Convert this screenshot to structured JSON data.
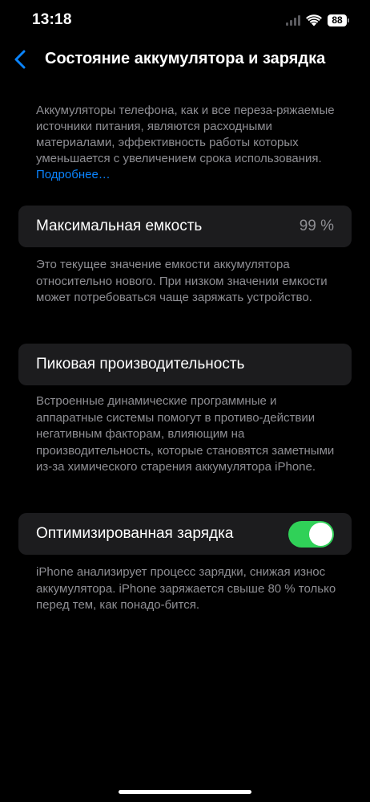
{
  "status_bar": {
    "time": "13:18",
    "battery_level": "88"
  },
  "nav": {
    "title": "Состояние аккумулятора и зарядка"
  },
  "intro": {
    "text": "Аккумуляторы телефона, как и все переза-ряжаемые источники питания, являются расходными материалами, эффективность работы которых уменьшается с увеличением срока использования. ",
    "link": "Подробнее…"
  },
  "max_capacity": {
    "label": "Максимальная емкость",
    "value": "99 %",
    "footnote": "Это текущее значение емкости аккумулятора относительно нового. При низком значении емкости может потребоваться чаще заряжать устройство."
  },
  "peak_performance": {
    "label": "Пиковая производительность",
    "footnote": "Встроенные динамические программные и аппаратные системы помогут в противо-действии негативным факторам, влияющим на производительность, которые становятся заметными из-за химического старения аккумулятора iPhone."
  },
  "optimized_charging": {
    "label": "Оптимизированная зарядка",
    "enabled": true,
    "footnote": "iPhone анализирует процесс зарядки, снижая износ аккумулятора. iPhone заряжается свыше 80 % только перед тем, как понадо-бится."
  },
  "colors": {
    "background": "#000000",
    "cell": "#1c1c1e",
    "secondary_text": "#8e8e93",
    "link": "#0a84ff",
    "toggle_on": "#30d158"
  },
  "icons": {
    "back": "chevron-left-icon",
    "signal": "cellular-signal-icon",
    "wifi": "wifi-icon",
    "battery": "battery-icon"
  }
}
